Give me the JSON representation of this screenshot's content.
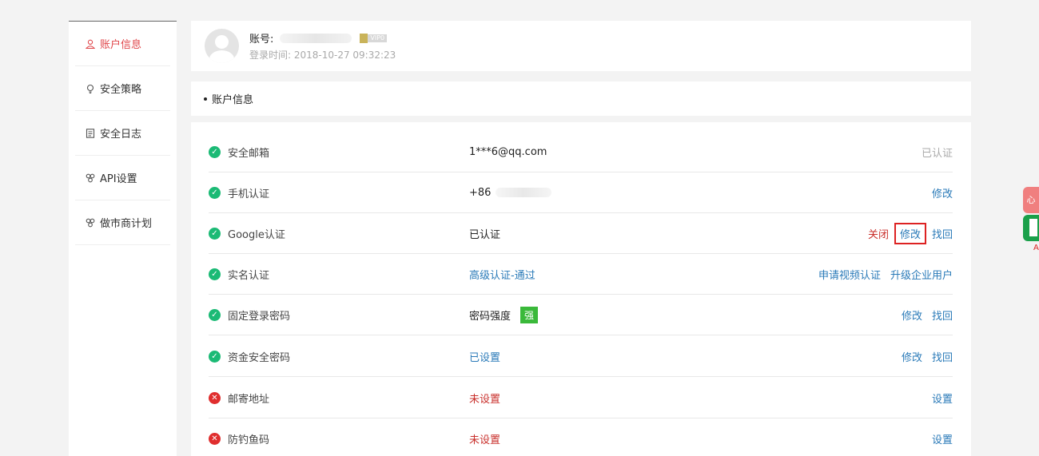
{
  "sidebar": {
    "items": [
      {
        "label": "账户信息",
        "icon": "user-icon"
      },
      {
        "label": "安全策略",
        "icon": "lightbulb-icon"
      },
      {
        "label": "安全日志",
        "icon": "document-icon"
      },
      {
        "label": "API设置",
        "icon": "api-icon"
      },
      {
        "label": "做市商计划",
        "icon": "api-icon"
      }
    ]
  },
  "header": {
    "account_label": "账号:",
    "vip_badge": "VIP0",
    "login_time": "登录时间: 2018-10-27 09:32:23"
  },
  "section": {
    "title": "账户信息"
  },
  "rows": [
    {
      "label": "安全邮箱",
      "value": "1***6@qq.com",
      "status": "ok",
      "actions": [
        "已认证"
      ]
    },
    {
      "label": "手机认证",
      "value": "+86",
      "status": "ok",
      "actions": [
        "修改"
      ]
    },
    {
      "label": "Google认证",
      "value": "已认证",
      "status": "ok",
      "actions": [
        "关闭",
        "修改",
        "找回"
      ]
    },
    {
      "label": "实名认证",
      "value": "高级认证-通过",
      "status": "ok",
      "actions": [
        "申请视频认证",
        "升级企业用户"
      ]
    },
    {
      "label": "固定登录密码",
      "value": "密码强度",
      "strength": "强",
      "status": "ok",
      "actions": [
        "修改",
        "找回"
      ]
    },
    {
      "label": "资金安全密码",
      "value": "已设置",
      "status": "ok",
      "actions": [
        "修改",
        "找回"
      ]
    },
    {
      "label": "邮寄地址",
      "value": "未设置",
      "status": "bad",
      "actions": [
        "设置"
      ]
    },
    {
      "label": "防钓鱼码",
      "value": "未设置",
      "status": "bad",
      "actions": [
        "设置"
      ]
    }
  ],
  "floating": {
    "red_glyph": "心",
    "bottom_mark": "A"
  },
  "colors": {
    "accent_red": "#e0474b",
    "link_blue": "#2a7ab8",
    "ok_green": "#1bba75",
    "strength_green": "#3ab93a"
  }
}
